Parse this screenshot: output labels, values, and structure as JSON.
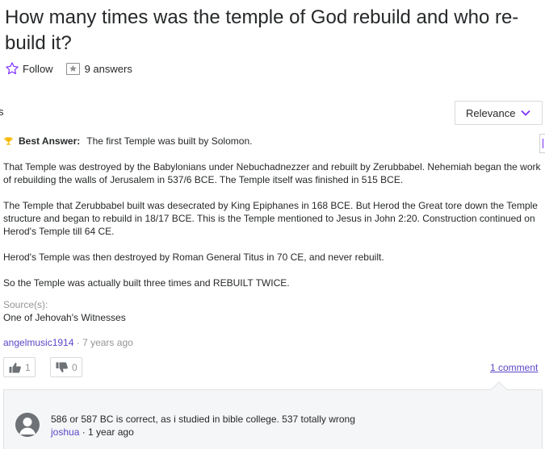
{
  "question": {
    "title": "How many times was the temple of God rebuild and who re-build it?",
    "follow_label": "Follow",
    "answers_count": "9 answers"
  },
  "edge_text": "s",
  "sort": {
    "selected": "Relevance"
  },
  "best_answer": {
    "label": "Best Answer:",
    "intro": "The first Temple was built by Solomon.",
    "paragraphs": [
      "That Temple was destroyed by the Babylonians under Nebuchadnezzer and rebuilt by Zerubbabel. Nehemiah began the work of rebuilding the walls of Jerusalem in 537/6 BCE. The Temple itself was finished in 515 BCE.",
      "The Temple that Zerubbabel built was desecrated by King Epiphanes in 168 BCE. But Herod the Great tore down the Temple structure and began to rebuild in 18/17 BCE. This is the Temple mentioned to Jesus in John 2:20. Construction continued on Herod's Temple till 64 CE.",
      "Herod's Temple was then destroyed by Roman General Titus in 70 CE, and never rebuilt.",
      "So the Temple was actually built three times and REBUILT TWICE."
    ],
    "source_label": "Source(s):",
    "source_value": "One of Jehovah's Witnesses",
    "author": "angelmusic1914",
    "separator": " · ",
    "time": "7 years ago",
    "upvotes": "1",
    "downvotes": "0",
    "comments_link": "1 comment"
  },
  "comment": {
    "text": "586 or 587 BC is correct, as i studied in bible college. 537 totally wrong",
    "author": "joshua",
    "separator": " · ",
    "time": "1 year ago"
  },
  "colors": {
    "link": "#5a47c8",
    "accent": "#7d2eff",
    "trophy": "#f5b800",
    "muted": "#959595"
  }
}
